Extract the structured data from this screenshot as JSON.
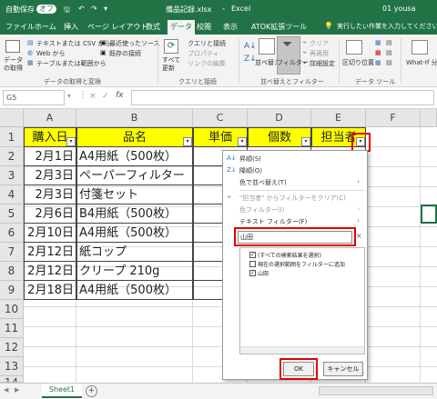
{
  "titlebar": {
    "autosave": "自動保存",
    "autosave_state": "オフ",
    "filename": "備品記録.xlsx",
    "separator": "-",
    "app": "Excel",
    "user": "01 yousa"
  },
  "menu": {
    "tabs": [
      "ファイル",
      "ホーム",
      "挿入",
      "ページ レイアウト",
      "数式",
      "データ",
      "校閲",
      "表示",
      "ATOK拡張ツール"
    ],
    "active": "データ",
    "tell_me": "実行したい作業を入力してください"
  },
  "ribbon": {
    "get_data": "データの取得",
    "from_text_csv": "テキストまたは CSV から",
    "from_web": "Web から",
    "from_table": "テーブルまたは範囲から",
    "recent_sources": "最近使ったソース",
    "existing_connections": "既存の接続",
    "refresh_all": "すべて更新",
    "queries_connections": "クエリと接続",
    "properties": "プロパティ",
    "edit_links": "リンクの編集",
    "sort": "並べ替え",
    "filter": "フィルター",
    "clear": "クリア",
    "reapply": "再適用",
    "advanced": "詳細設定",
    "text_to_columns": "区切り位置",
    "whatif": "What-If 分析",
    "group_get": "データの取得と変換",
    "group_queries": "クエリと接続",
    "group_sort": "並べ替えとフィルター",
    "group_tools": "データ ツール"
  },
  "formula": {
    "namebox": "G5",
    "fx": "fx",
    "cancel": "×",
    "enter": "✓"
  },
  "grid": {
    "columns": [
      "A",
      "B",
      "C",
      "D",
      "E",
      "F"
    ],
    "rows": [
      "1",
      "2",
      "3",
      "4",
      "5",
      "6",
      "7",
      "8",
      "9",
      "10",
      "11",
      "12",
      "13",
      "14"
    ],
    "headers": [
      "購入日",
      "品名",
      "単価",
      "個数",
      "担当者"
    ],
    "data": [
      [
        "2月1日",
        "A4用紙（500枚）"
      ],
      [
        "2月3日",
        "ペーパーフィルター"
      ],
      [
        "2月3日",
        "付箋セット"
      ],
      [
        "2月6日",
        "B4用紙（500枚）"
      ],
      [
        "2月10日",
        "A4用紙（500枚）"
      ],
      [
        "2月12日",
        "紙コップ"
      ],
      [
        "2月12日",
        "クリープ 210g"
      ],
      [
        "2月18日",
        "A4用紙（500枚）"
      ]
    ]
  },
  "filter_panel": {
    "sort_asc": "昇順(S)",
    "sort_desc": "降順(O)",
    "sort_by_color": "色で並べ替え(T)",
    "clear_filter": "\"担当者\" からフィルターをクリア(C)",
    "color_filter": "色フィルター(I)",
    "text_filter": "テキスト フィルター(F)",
    "search_value": "山田",
    "clear_search": "×",
    "items": [
      "(すべての検索結果を選択)",
      "現在の選択範囲をフィルターに追加",
      "山田"
    ],
    "checked": [
      true,
      false,
      true
    ],
    "ok": "OK",
    "cancel": "キャンセル"
  },
  "sheetbar": {
    "sheet": "Sheet1",
    "add": "+"
  },
  "colors": {
    "excel_green": "#217346",
    "header_yellow": "#ffff00",
    "highlight_red": "#e00000"
  }
}
